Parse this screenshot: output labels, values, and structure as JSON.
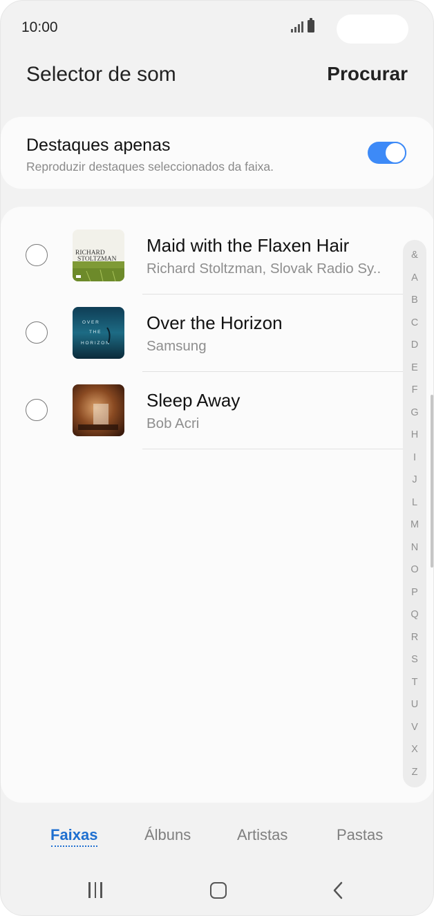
{
  "status_bar": {
    "time": "10:00"
  },
  "header": {
    "title": "Selector de som",
    "search_label": "Procurar"
  },
  "highlights": {
    "title": "Destaques apenas",
    "subtitle": "Reproduzir destaques seleccionados da faixa.",
    "enabled": true,
    "accent_color": "#3d8af7"
  },
  "tracks": [
    {
      "title": "Maid with the Flaxen Hair",
      "artist": "Richard Stoltzman, Slovak Radio Sy..",
      "selected": false,
      "art_text": [
        "RICHARD",
        "STOLTZMAN"
      ]
    },
    {
      "title": "Over the Horizon",
      "artist": "Samsung",
      "selected": false,
      "art_text": [
        "O V E R",
        "T H E",
        "H O R I Z O N"
      ]
    },
    {
      "title": "Sleep Away",
      "artist": "Bob Acri",
      "selected": false
    }
  ],
  "index_letters": [
    "&",
    "A",
    "B",
    "C",
    "D",
    "E",
    "F",
    "G",
    "H",
    "I",
    "J",
    "L",
    "M",
    "N",
    "O",
    "P",
    "Q",
    "R",
    "S",
    "T",
    "U",
    "V",
    "X",
    "Z"
  ],
  "tabs": [
    {
      "label": "Faixas",
      "active": true
    },
    {
      "label": "Álbuns",
      "active": false
    },
    {
      "label": "Artistas",
      "active": false
    },
    {
      "label": "Pastas",
      "active": false
    }
  ],
  "active_tab_color": "#1e6fd0",
  "nav_icons": [
    "recents-icon",
    "home-icon",
    "back-icon"
  ]
}
